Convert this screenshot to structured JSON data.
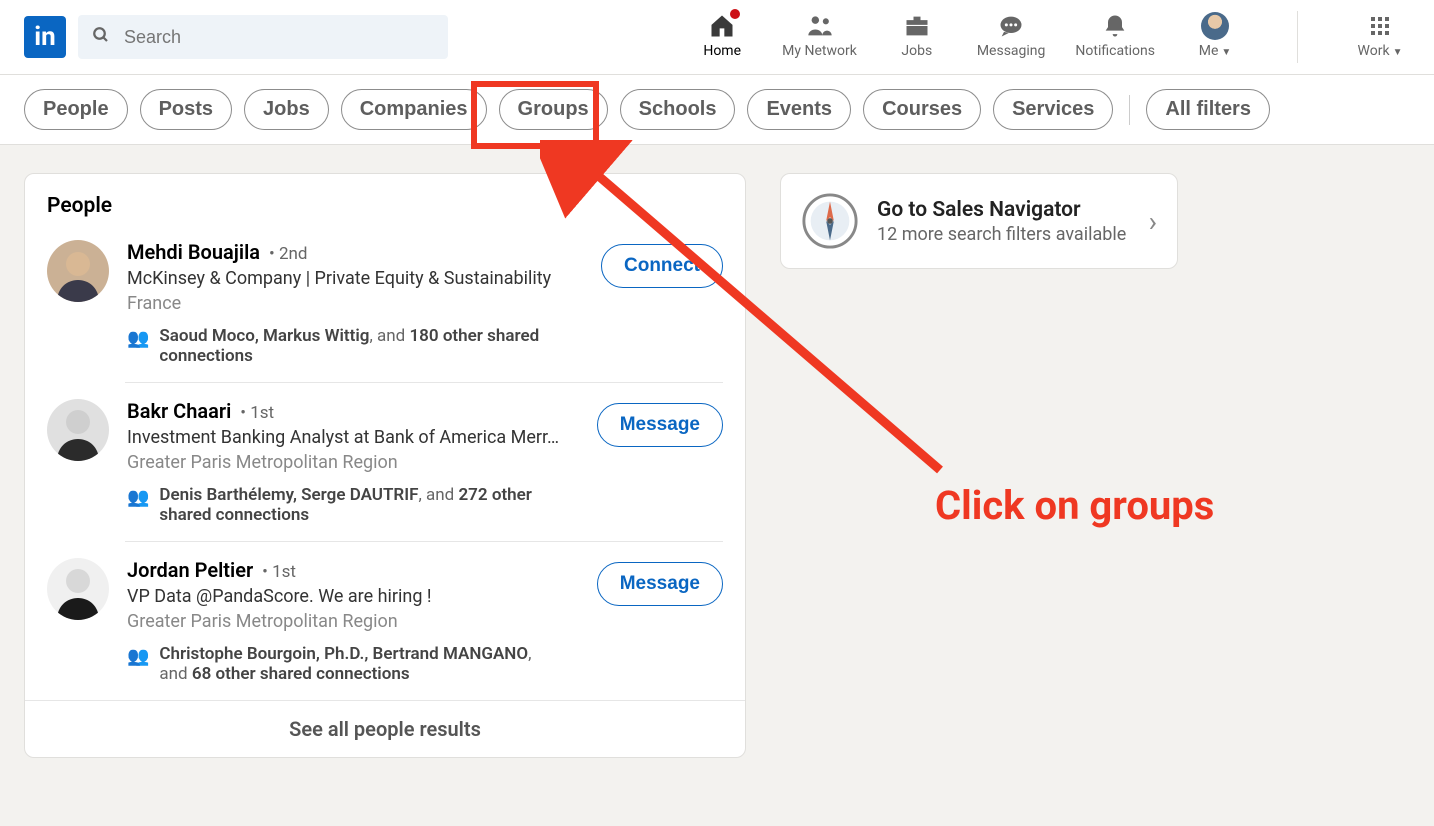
{
  "search": {
    "placeholder": "Search"
  },
  "nav": {
    "home": "Home",
    "network": "My Network",
    "jobs": "Jobs",
    "messaging": "Messaging",
    "notifications": "Notifications",
    "me": "Me",
    "work": "Work"
  },
  "filters": {
    "people": "People",
    "posts": "Posts",
    "jobs": "Jobs",
    "companies": "Companies",
    "groups": "Groups",
    "schools": "Schools",
    "events": "Events",
    "courses": "Courses",
    "services": "Services",
    "all": "All filters"
  },
  "people_card": {
    "header": "People",
    "see_all": "See all people results"
  },
  "results": [
    {
      "name": "Mehdi Bouajila",
      "degree": "2nd",
      "title": "McKinsey & Company | Private Equity & Sustainability",
      "location": "France",
      "shared_prefix": "Saoud Moco, Markus Wittig",
      "shared_suffix": "180 other shared connections",
      "action": "Connect"
    },
    {
      "name": "Bakr Chaari",
      "degree": "1st",
      "title": "Investment Banking Analyst at Bank of America Merr…",
      "location": "Greater Paris Metropolitan Region",
      "shared_prefix": "Denis Barthélemy, Serge DAUTRIF",
      "shared_suffix": "272 other shared connections",
      "action": "Message"
    },
    {
      "name": "Jordan Peltier",
      "degree": "1st",
      "title": "VP Data @PandaScore. We are hiring !",
      "location": "Greater Paris Metropolitan Region",
      "shared_prefix": "Christophe Bourgoin, Ph.D., Bertrand MANGANO",
      "shared_suffix": "68 other shared connections",
      "action": "Message"
    }
  ],
  "side": {
    "title": "Go to Sales Navigator",
    "sub": "12 more search filters available"
  },
  "annotation": {
    "text": "Click on groups"
  }
}
